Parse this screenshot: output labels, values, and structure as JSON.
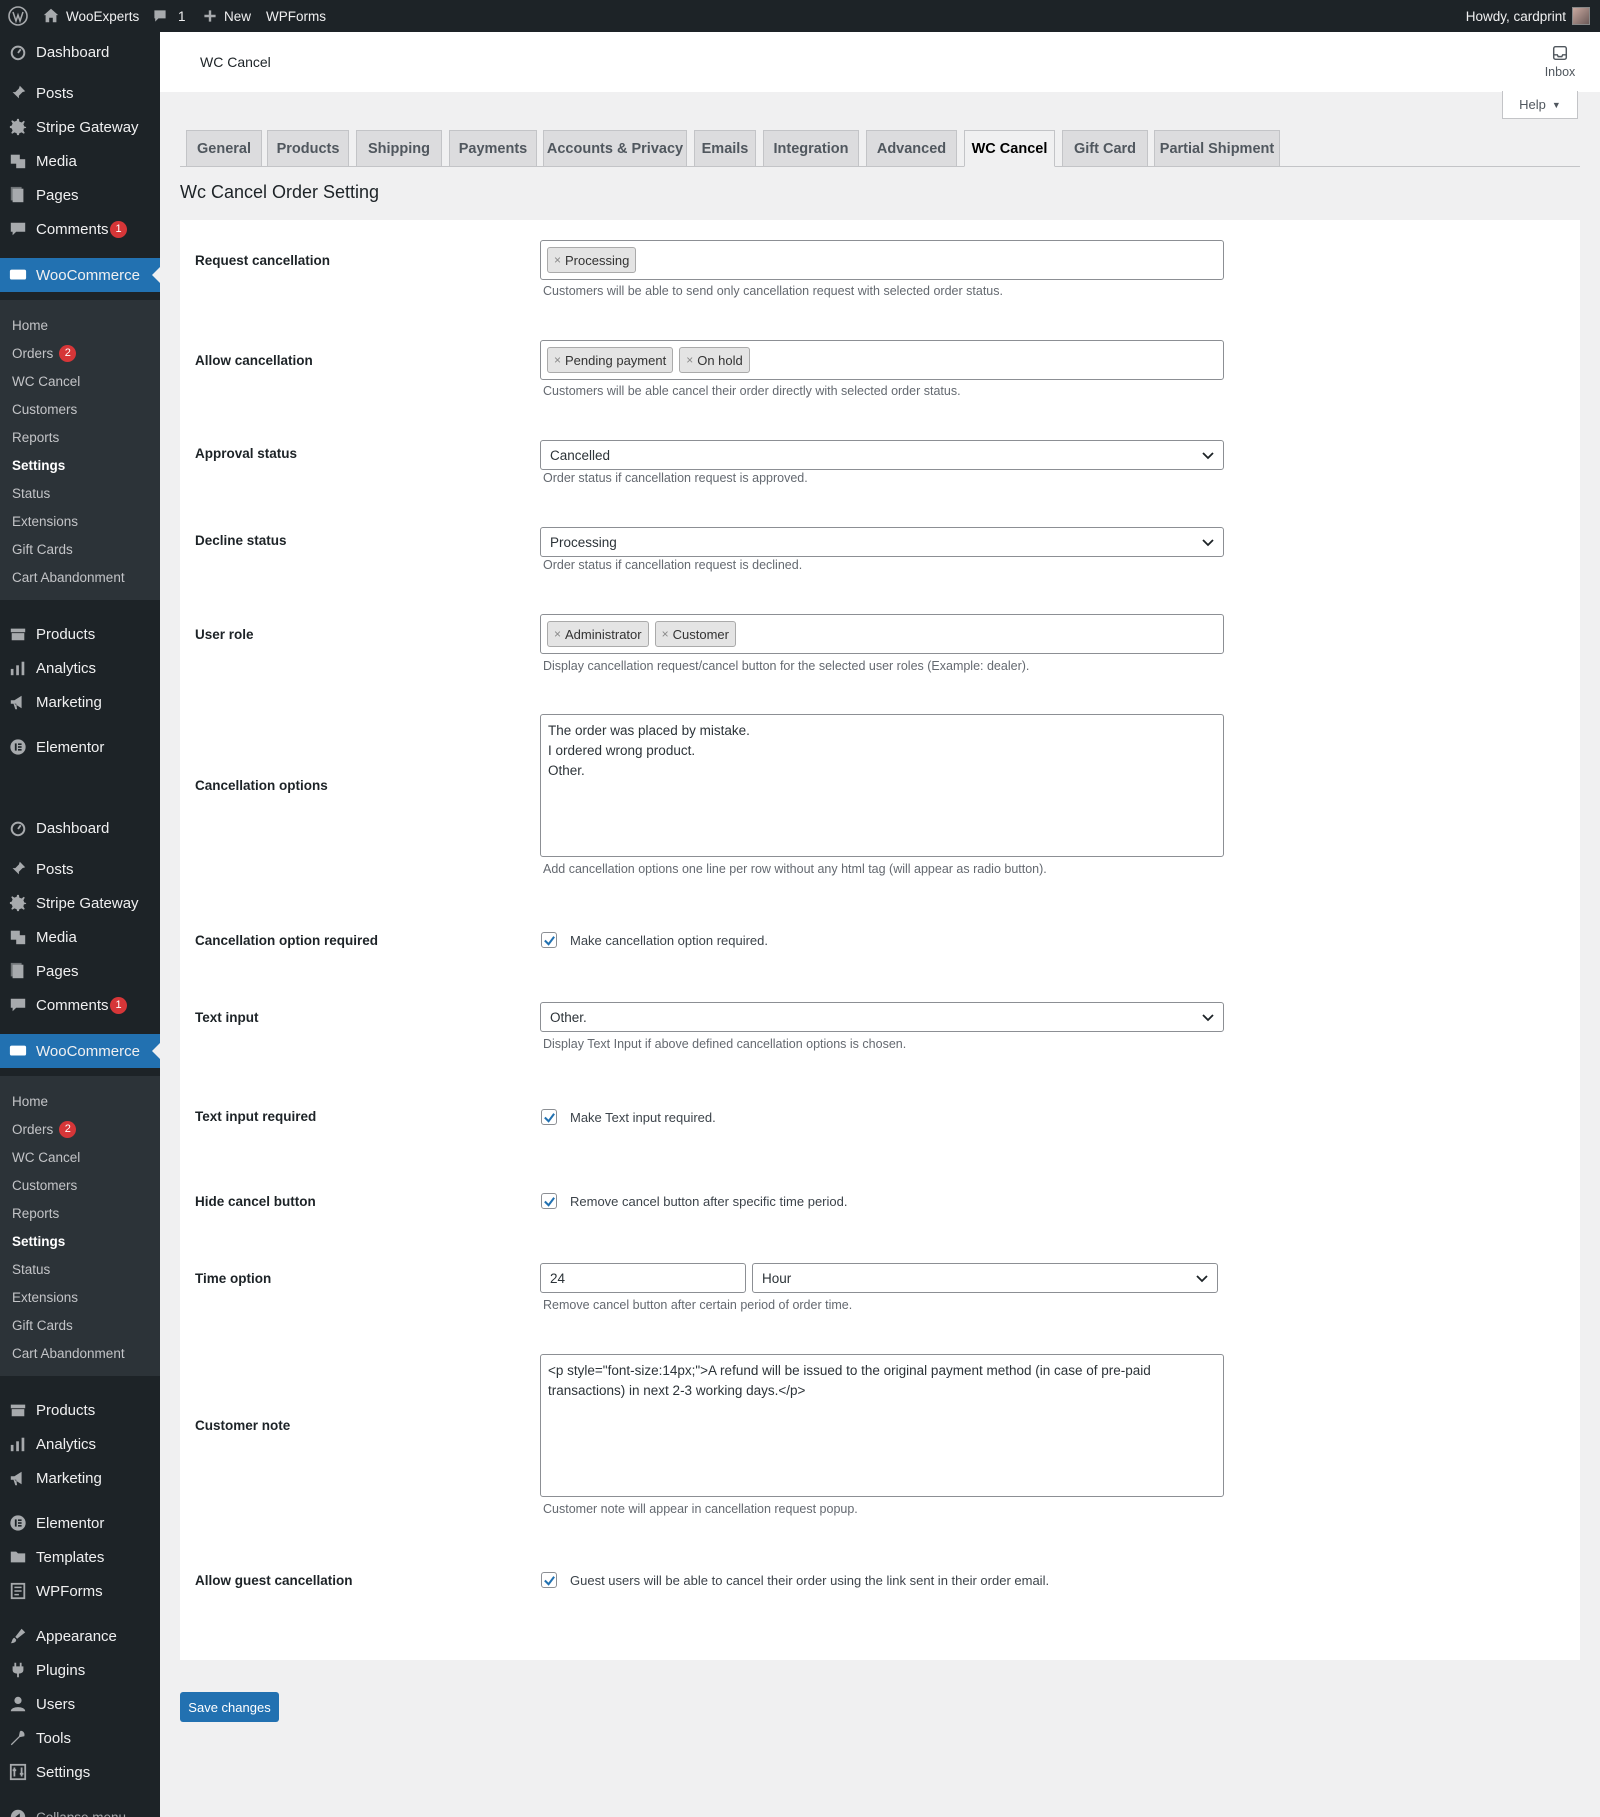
{
  "adminbar": {
    "site_name": "WooExperts",
    "comments_count": "1",
    "new_label": "New",
    "wpforms_label": "WPForms",
    "howdy": "Howdy, cardprint"
  },
  "sidebar": {
    "menu1": [
      {
        "label": "Dashboard",
        "icon": "dashboard-icon"
      },
      {
        "label": "Posts",
        "icon": "pin-icon"
      },
      {
        "label": "Stripe Gateway",
        "icon": "gear-icon"
      },
      {
        "label": "Media",
        "icon": "media-icon"
      },
      {
        "label": "Pages",
        "icon": "pages-icon"
      },
      {
        "label": "Comments",
        "icon": "comment-icon",
        "badge": "1"
      },
      {
        "label": "WooCommerce",
        "icon": "woo-icon"
      }
    ],
    "sub1": [
      {
        "label": "Home"
      },
      {
        "label": "Orders",
        "badge": "2"
      },
      {
        "label": "WC Cancel"
      },
      {
        "label": "Customers"
      },
      {
        "label": "Reports"
      },
      {
        "label": "Settings"
      },
      {
        "label": "Status"
      },
      {
        "label": "Extensions"
      },
      {
        "label": "Gift Cards"
      },
      {
        "label": "Cart Abandonment"
      }
    ],
    "menu2": [
      {
        "label": "Products",
        "icon": "products-icon"
      },
      {
        "label": "Analytics",
        "icon": "analytics-icon"
      },
      {
        "label": "Marketing",
        "icon": "megaphone-icon"
      },
      {
        "label": "Elementor",
        "icon": "elementor-icon"
      }
    ],
    "menu3": [
      {
        "label": "Dashboard",
        "icon": "dashboard-icon"
      },
      {
        "label": "Posts",
        "icon": "pin-icon"
      },
      {
        "label": "Stripe Gateway",
        "icon": "gear-icon"
      },
      {
        "label": "Media",
        "icon": "media-icon"
      },
      {
        "label": "Pages",
        "icon": "pages-icon"
      },
      {
        "label": "Comments",
        "icon": "comment-icon",
        "badge": "1"
      },
      {
        "label": "WooCommerce",
        "icon": "woo-icon"
      }
    ],
    "sub2": [
      {
        "label": "Home"
      },
      {
        "label": "Orders",
        "badge": "2"
      },
      {
        "label": "WC Cancel"
      },
      {
        "label": "Customers"
      },
      {
        "label": "Reports"
      },
      {
        "label": "Settings"
      },
      {
        "label": "Status"
      },
      {
        "label": "Extensions"
      },
      {
        "label": "Gift Cards"
      },
      {
        "label": "Cart Abandonment"
      }
    ],
    "menu4": [
      {
        "label": "Products",
        "icon": "products-icon"
      },
      {
        "label": "Analytics",
        "icon": "analytics-icon"
      },
      {
        "label": "Marketing",
        "icon": "megaphone-icon"
      },
      {
        "label": "Elementor",
        "icon": "elementor-icon"
      },
      {
        "label": "Templates",
        "icon": "folder-icon"
      },
      {
        "label": "WPForms",
        "icon": "forms-icon"
      },
      {
        "label": "Appearance",
        "icon": "brush-icon"
      },
      {
        "label": "Plugins",
        "icon": "plug-icon"
      },
      {
        "label": "Users",
        "icon": "user-icon"
      },
      {
        "label": "Tools",
        "icon": "wrench-icon"
      },
      {
        "label": "Settings",
        "icon": "settings-icon"
      },
      {
        "label": "Collapse menu",
        "icon": "collapse-icon"
      }
    ]
  },
  "header": {
    "title": "WC Cancel",
    "inbox_label": "Inbox",
    "help_label": "Help"
  },
  "tabs": [
    "General",
    "Products",
    "Shipping",
    "Payments",
    "Accounts & Privacy",
    "Emails",
    "Integration",
    "Advanced",
    "WC Cancel",
    "Gift Card",
    "Partial Shipment"
  ],
  "active_tab": "WC Cancel",
  "page_title": "Wc Cancel Order Setting",
  "form": {
    "request_cancellation": {
      "label": "Request cancellation",
      "tags": [
        "Processing"
      ],
      "desc": "Customers will be able to send only cancellation request with selected order status."
    },
    "allow_cancellation": {
      "label": "Allow cancellation",
      "tags": [
        "Pending payment",
        "On hold"
      ],
      "desc": "Customers will be able cancel their order directly with selected order status."
    },
    "approval_status": {
      "label": "Approval status",
      "value": "Cancelled",
      "desc": "Order status if cancellation request is approved."
    },
    "decline_status": {
      "label": "Decline status",
      "value": "Processing",
      "desc": "Order status if cancellation request is declined."
    },
    "user_role": {
      "label": "User role",
      "tags": [
        "Administrator",
        "Customer"
      ],
      "desc": "Display cancellation request/cancel button for the selected user roles (Example: dealer)."
    },
    "cancellation_options": {
      "label": "Cancellation options",
      "lines": [
        "The order was placed by mistake.",
        "I ordered wrong product.",
        "Other."
      ],
      "desc": "Add cancellation options one line per row without any html tag (will appear as radio button)."
    },
    "option_required": {
      "label": "Cancellation option required",
      "checked": true,
      "text": "Make cancellation option required."
    },
    "text_input": {
      "label": "Text input",
      "value": "Other.",
      "desc": "Display Text Input if above defined cancellation options is chosen."
    },
    "text_input_required": {
      "label": "Text input required",
      "checked": true,
      "text": "Make Text input required."
    },
    "hide_cancel": {
      "label": "Hide cancel button",
      "checked": true,
      "text": "Remove cancel button after specific time period."
    },
    "time_option": {
      "label": "Time option",
      "number": "24",
      "unit": "Hour",
      "desc": "Remove cancel button after certain period of order time."
    },
    "customer_note": {
      "label": "Customer note",
      "value": "<p style=\"font-size:14px;\">A refund will be issued to the original payment method (in case of pre-paid transactions) in next 2-3 working days.</p>",
      "desc": "Customer note will appear in cancellation request popup."
    },
    "guest_cancellation": {
      "label": "Allow guest cancellation",
      "checked": true,
      "text": "Guest users will be able to cancel their order using the link sent in their order email."
    }
  },
  "save_label": "Save changes",
  "colors": {
    "primary": "#2271b1",
    "sidebar": "#1d2327",
    "submenu": "#2c3338",
    "badge": "#d63638"
  }
}
